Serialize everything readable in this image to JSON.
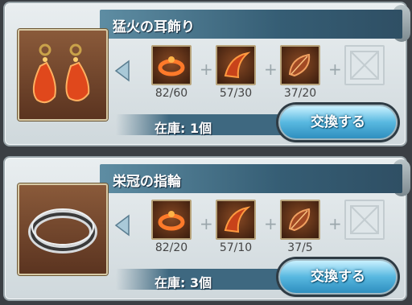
{
  "recipes": [
    {
      "title": "猛火の耳飾り",
      "item_icon": "earring-icon",
      "materials": [
        {
          "icon": "fire-ring-material-icon",
          "count": "82/60"
        },
        {
          "icon": "fire-horn-material-icon",
          "count": "57/30"
        },
        {
          "icon": "fire-feather-material-icon",
          "count": "37/20"
        },
        {
          "icon": "empty-slot-icon",
          "count": ""
        }
      ],
      "stock": "在庫: 1個",
      "button_label": "交換する"
    },
    {
      "title": "栄冠の指輪",
      "item_icon": "silver-ring-icon",
      "materials": [
        {
          "icon": "fire-ring-material-icon",
          "count": "82/20"
        },
        {
          "icon": "fire-horn-material-icon",
          "count": "57/10"
        },
        {
          "icon": "fire-feather-material-icon",
          "count": "37/5"
        },
        {
          "icon": "empty-slot-icon",
          "count": ""
        }
      ],
      "stock": "在庫: 3個",
      "button_label": "交換する"
    }
  ]
}
